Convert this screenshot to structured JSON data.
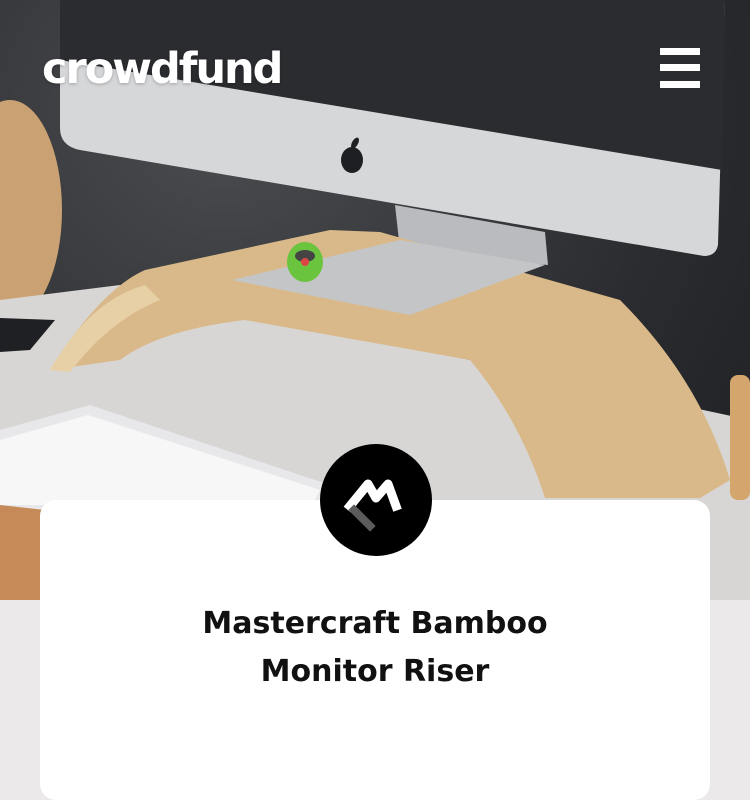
{
  "brand": {
    "name": "crowdfund"
  },
  "header": {
    "menu_icon": "hamburger-menu-icon"
  },
  "campaign": {
    "badge_icon": "stylized-m-logo-icon",
    "title_line1": "Mastercraft Bamboo",
    "title_line2": "Monitor Riser"
  },
  "colors": {
    "card": "#ffffff",
    "page_bg": "#ebe9ea",
    "badge": "#000000",
    "text": "#111111"
  }
}
